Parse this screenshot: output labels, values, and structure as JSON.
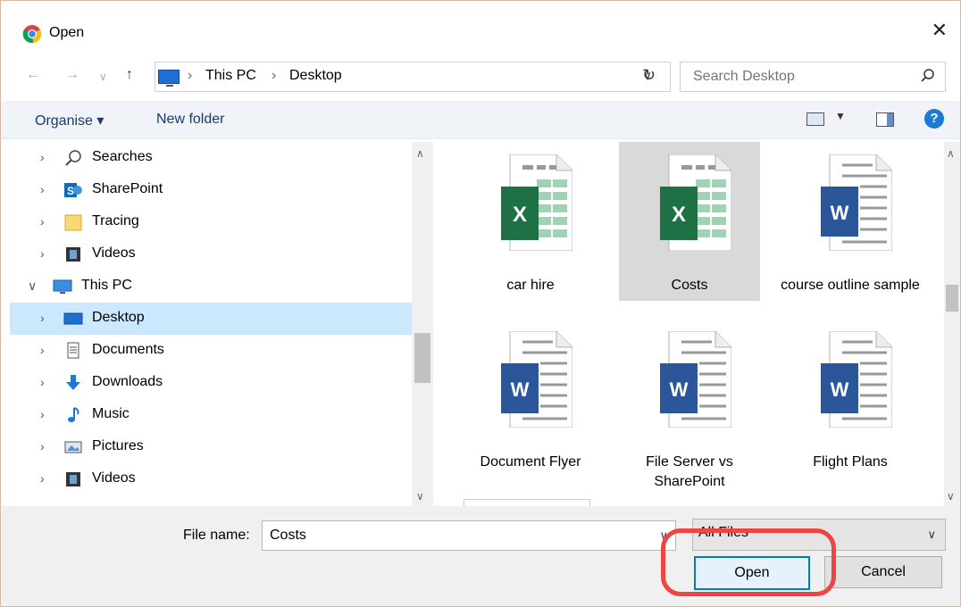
{
  "window": {
    "title": "Open"
  },
  "address": {
    "crumbs": [
      "This PC",
      "Desktop"
    ],
    "separator": "›"
  },
  "search": {
    "placeholder": "Search Desktop"
  },
  "toolbar": {
    "organise": "Organise ▾",
    "new_folder": "New folder",
    "help": "?"
  },
  "nav": {
    "items": [
      {
        "label": "Searches",
        "icon": "search-icon"
      },
      {
        "label": "SharePoint",
        "icon": "sharepoint-icon"
      },
      {
        "label": "Tracing",
        "icon": "folder-icon"
      },
      {
        "label": "Videos",
        "icon": "video-icon"
      },
      {
        "label": "This PC",
        "icon": "pc-icon",
        "expanded": true
      },
      {
        "label": "Desktop",
        "icon": "desktop-icon",
        "selected": true
      },
      {
        "label": "Documents",
        "icon": "documents-icon"
      },
      {
        "label": "Downloads",
        "icon": "downloads-icon"
      },
      {
        "label": "Music",
        "icon": "music-icon"
      },
      {
        "label": "Pictures",
        "icon": "pictures-icon"
      },
      {
        "label": "Videos",
        "icon": "video-icon"
      }
    ]
  },
  "files": [
    {
      "name": "car hire",
      "type": "excel"
    },
    {
      "name": "Costs",
      "type": "excel",
      "selected": true
    },
    {
      "name": "course outline sample",
      "type": "word"
    },
    {
      "name": "Document Flyer",
      "type": "word"
    },
    {
      "name": "File Server vs SharePoint",
      "type": "word"
    },
    {
      "name": "Flight Plans",
      "type": "word"
    }
  ],
  "footer": {
    "file_name_label": "File name:",
    "file_name_value": "Costs",
    "filter_value": "All Files",
    "open_label": "Open",
    "cancel_label": "Cancel"
  },
  "colors": {
    "excel": "#1e7145",
    "word": "#2b579a",
    "selection": "#cce8ff",
    "highlight": "#e44444"
  }
}
